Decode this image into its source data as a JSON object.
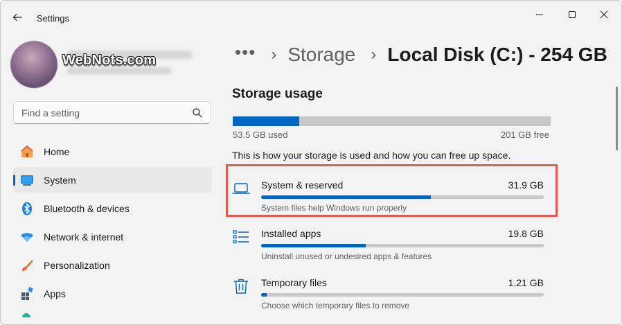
{
  "window": {
    "title": "Settings",
    "watermark": "WebNots.com"
  },
  "search": {
    "placeholder": "Find a setting"
  },
  "nav": {
    "items": [
      {
        "label": "Home",
        "icon": "home-icon"
      },
      {
        "label": "System",
        "icon": "system-icon",
        "active": true
      },
      {
        "label": "Bluetooth & devices",
        "icon": "bluetooth-icon"
      },
      {
        "label": "Network & internet",
        "icon": "wifi-icon"
      },
      {
        "label": "Personalization",
        "icon": "brush-icon"
      },
      {
        "label": "Apps",
        "icon": "apps-icon"
      }
    ]
  },
  "breadcrumb": {
    "more": "•••",
    "parent": "Storage",
    "current": "Local Disk (C:) - 254 GB"
  },
  "storage": {
    "section_title": "Storage usage",
    "used_label": "53.5 GB used",
    "free_label": "201 GB free",
    "used_fraction": 0.21,
    "info": "This is how your storage is used and how you can free up space.",
    "categories": [
      {
        "name": "System & reserved",
        "size": "31.9 GB",
        "description": "System files help Windows run properly",
        "fraction": 0.6,
        "icon": "laptop-icon"
      },
      {
        "name": "Installed apps",
        "size": "19.8 GB",
        "description": "Uninstall unused or undesired apps & features",
        "fraction": 0.37,
        "icon": "list-icon"
      },
      {
        "name": "Temporary files",
        "size": "1.21 GB",
        "description": "Choose which temporary files to remove",
        "fraction": 0.02,
        "icon": "trash-icon"
      }
    ]
  },
  "colors": {
    "accent": "#0067c0",
    "highlight": "#e25a4e",
    "bar_track": "#c7c7c7"
  }
}
